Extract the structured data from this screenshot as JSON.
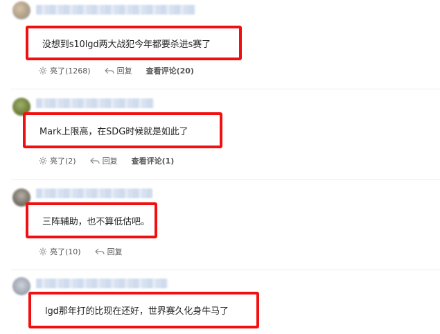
{
  "comments": [
    {
      "text": "没想到s10lgd两大战犯今年都要杀进s赛了",
      "like_label": "亮了(1268)",
      "reply_label": "回复",
      "view_replies_label": "查看评论(20)"
    },
    {
      "text": "Mark上限高，在SDG时候就是如此了",
      "like_label": "亮了(2)",
      "reply_label": "回复",
      "view_replies_label": "查看评论(1)"
    },
    {
      "text": "三阵辅助，也不算低估吧。",
      "like_label": "亮了(10)",
      "reply_label": "回复"
    },
    {
      "text": "lgd那年打的比现在还好，世界赛久化身牛马了"
    }
  ],
  "colors": {
    "highlight_border": "#f10f0f",
    "divider": "#ececec",
    "action_text": "#555555"
  },
  "icons": [
    "like-icon",
    "reply-icon"
  ]
}
